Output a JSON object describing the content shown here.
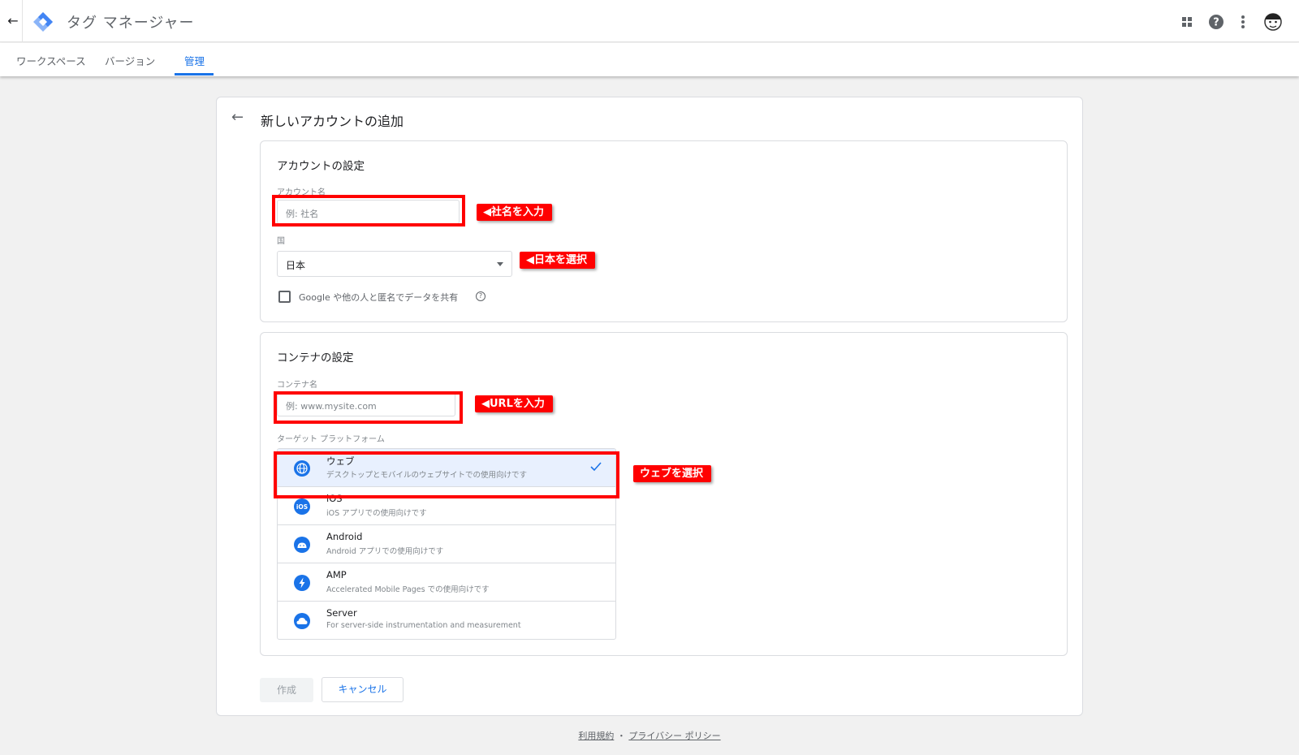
{
  "header": {
    "app_title": "タグ マネージャー",
    "icons": [
      "back-arrow-icon",
      "gtm-logo-icon",
      "apps-grid-icon",
      "help-icon",
      "more-vert-icon",
      "avatar"
    ]
  },
  "tabs": [
    {
      "label": "ワークスペース"
    },
    {
      "label": "バージョン"
    },
    {
      "label": "管理",
      "active": true
    }
  ],
  "page": {
    "title": "新しいアカウントの追加"
  },
  "account_section": {
    "title": "アカウントの設定",
    "name_label": "アカウント名",
    "name_placeholder": "例: 社名",
    "country_label": "国",
    "country_value": "日本",
    "share_label": "Google や他の人と匿名でデータを共有"
  },
  "container_section": {
    "title": "コンテナの設定",
    "name_label": "コンテナ名",
    "name_placeholder": "例: www.mysite.com",
    "platform_label": "ターゲット プラットフォーム",
    "platforms": [
      {
        "name": "ウェブ",
        "desc": "デスクトップとモバイルのウェブサイトでの使用向けです",
        "selected": true
      },
      {
        "name": "iOS",
        "desc": "iOS アプリでの使用向けです"
      },
      {
        "name": "Android",
        "desc": "Android アプリでの使用向けです"
      },
      {
        "name": "AMP",
        "desc": "Accelerated Mobile Pages での使用向けです"
      },
      {
        "name": "Server",
        "desc": "For server-side instrumentation and measurement"
      }
    ]
  },
  "buttons": {
    "create": "作成",
    "cancel": "キャンセル"
  },
  "annotations": {
    "company": "◀社名を入力",
    "country": "◀日本を選択",
    "url": "◀URLを入力",
    "web": "ウェブを選択"
  },
  "footer": {
    "terms": "利用規約",
    "separator": "・",
    "privacy": "プライバシー ポリシー"
  },
  "colors": {
    "accent": "#1a73e8",
    "annotation_red": "#ff0000"
  }
}
